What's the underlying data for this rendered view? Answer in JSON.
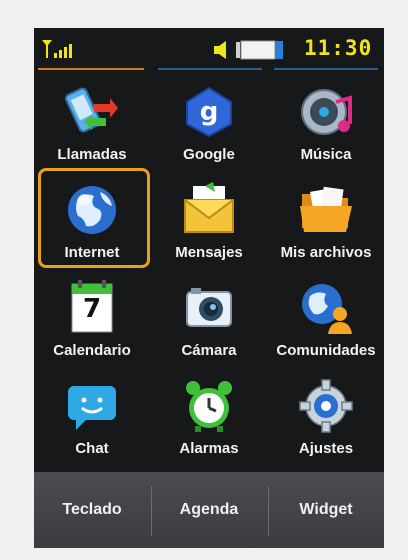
{
  "status_bar": {
    "time": "11:30",
    "icons": [
      "signal-icon",
      "speaker-icon",
      "battery-icon"
    ]
  },
  "apps": [
    {
      "label": "Llamadas",
      "icon": "phone-calls-icon"
    },
    {
      "label": "Google",
      "icon": "google-icon"
    },
    {
      "label": "Música",
      "icon": "music-icon"
    },
    {
      "label": "Internet",
      "icon": "globe-icon",
      "selected": true
    },
    {
      "label": "Mensajes",
      "icon": "envelope-icon"
    },
    {
      "label": "Mis archivos",
      "icon": "folder-icon"
    },
    {
      "label": "Calendario",
      "icon": "calendar-icon",
      "day": "7"
    },
    {
      "label": "Cámara",
      "icon": "camera-icon"
    },
    {
      "label": "Comunidades",
      "icon": "communities-icon"
    },
    {
      "label": "Chat",
      "icon": "chat-icon"
    },
    {
      "label": "Alarmas",
      "icon": "alarm-clock-icon"
    },
    {
      "label": "Ajustes",
      "icon": "gear-icon"
    }
  ],
  "tabs": [
    {
      "label": "Teclado"
    },
    {
      "label": "Agenda"
    },
    {
      "label": "Widget"
    }
  ],
  "colors": {
    "selection": "#e8a21a",
    "clock": "#f2e41a",
    "screen_bg": "#16181a"
  }
}
